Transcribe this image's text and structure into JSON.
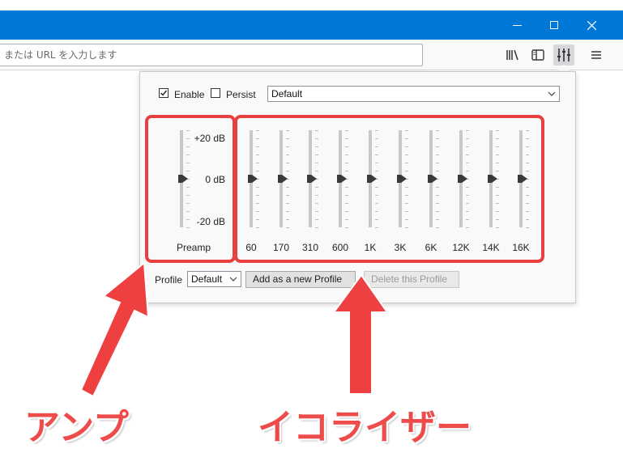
{
  "window": {
    "minimize_icon": "minimize-icon",
    "maximize_icon": "maximize-icon",
    "close_icon": "close-icon"
  },
  "toolbar": {
    "url_placeholder": "または URL を入力します",
    "icons": [
      "library-icon",
      "sidebar-icon",
      "equalizer-icon",
      "hamburger-menu-icon"
    ]
  },
  "panel": {
    "enable_label": "Enable",
    "enable_checked": true,
    "persist_label": "Persist",
    "persist_checked": false,
    "preset_value": "Default",
    "db_labels": [
      "+20 dB",
      "0 dB",
      "-20 dB"
    ],
    "preamp_label": "Preamp",
    "preamp_value_db": 0,
    "bands": [
      {
        "label": "60",
        "value_db": 0
      },
      {
        "label": "170",
        "value_db": 0
      },
      {
        "label": "310",
        "value_db": 0
      },
      {
        "label": "600",
        "value_db": 0
      },
      {
        "label": "1K",
        "value_db": 0
      },
      {
        "label": "3K",
        "value_db": 0
      },
      {
        "label": "6K",
        "value_db": 0
      },
      {
        "label": "12K",
        "value_db": 0
      },
      {
        "label": "14K",
        "value_db": 0
      },
      {
        "label": "16K",
        "value_db": 0
      }
    ],
    "profile_label": "Profile",
    "profile_value": "Default",
    "add_profile_label": "Add as a new Profile",
    "delete_profile_label": "Delete this Profile"
  },
  "annotations": {
    "amp_label": "アンプ",
    "eq_label": "イコライザー",
    "highlight_color": "#e8403f"
  }
}
